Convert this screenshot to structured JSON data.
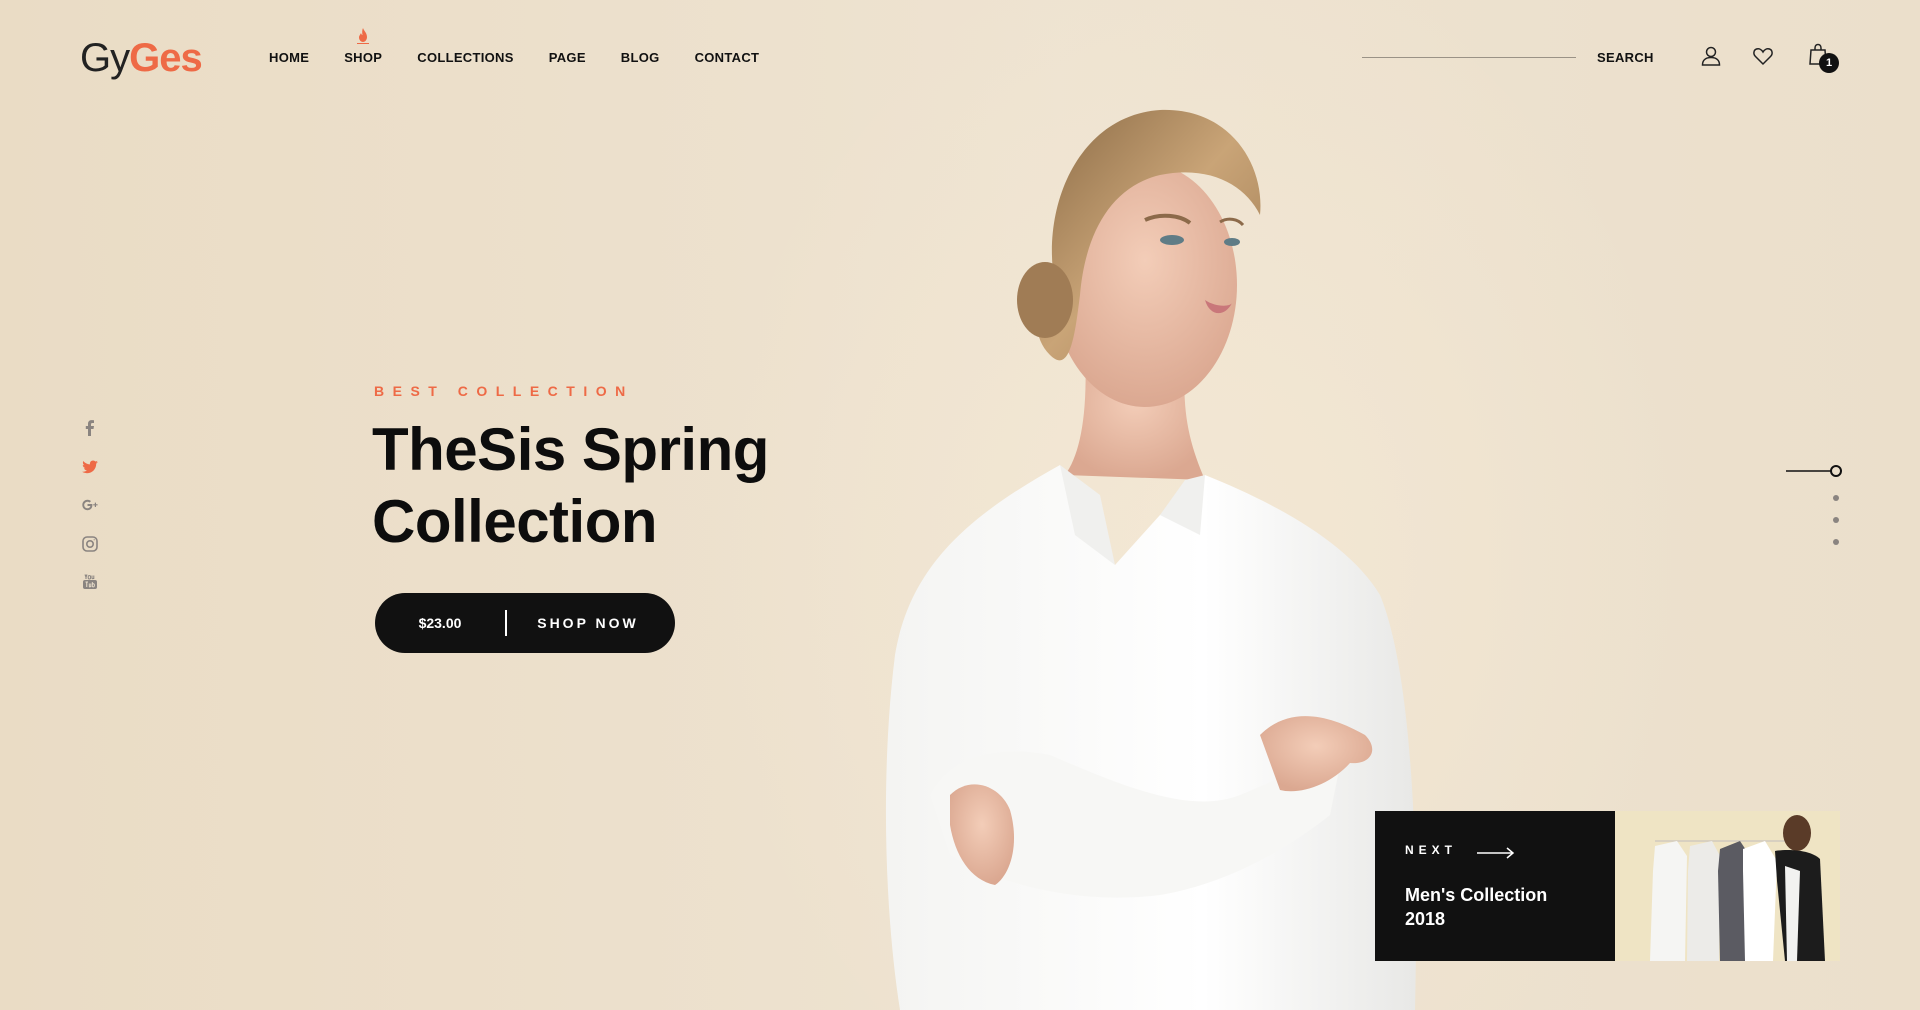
{
  "brand": {
    "logo_part1": "Gy",
    "logo_part2": "Ges"
  },
  "nav": {
    "items": [
      {
        "label": "HOME"
      },
      {
        "label": "SHOP",
        "hot": true
      },
      {
        "label": "COLLECTIONS"
      },
      {
        "label": "PAGE"
      },
      {
        "label": "BLOG"
      },
      {
        "label": "CONTACT"
      }
    ]
  },
  "header": {
    "search_label": "SEARCH",
    "cart_count": "1",
    "icons": [
      "user-icon",
      "heart-icon",
      "shopping-bag-icon"
    ]
  },
  "social": [
    "facebook-icon",
    "twitter-icon",
    "google-plus-icon",
    "instagram-icon",
    "youtube-icon"
  ],
  "hero": {
    "eyebrow": "BEST COLLECTION",
    "title_line1": "TheSis Spring",
    "title_line2": "Collection",
    "price": "$23.00",
    "cta_label": "SHOP NOW"
  },
  "slider": {
    "total": 4,
    "active": 1
  },
  "next_slide": {
    "label": "NEXT",
    "title_line1": "Men's Collection",
    "title_line2": "2018"
  },
  "colors": {
    "accent": "#ee6a46",
    "background": "#ebdfcb",
    "dark": "#111111",
    "icon_gray": "#8a8480"
  }
}
